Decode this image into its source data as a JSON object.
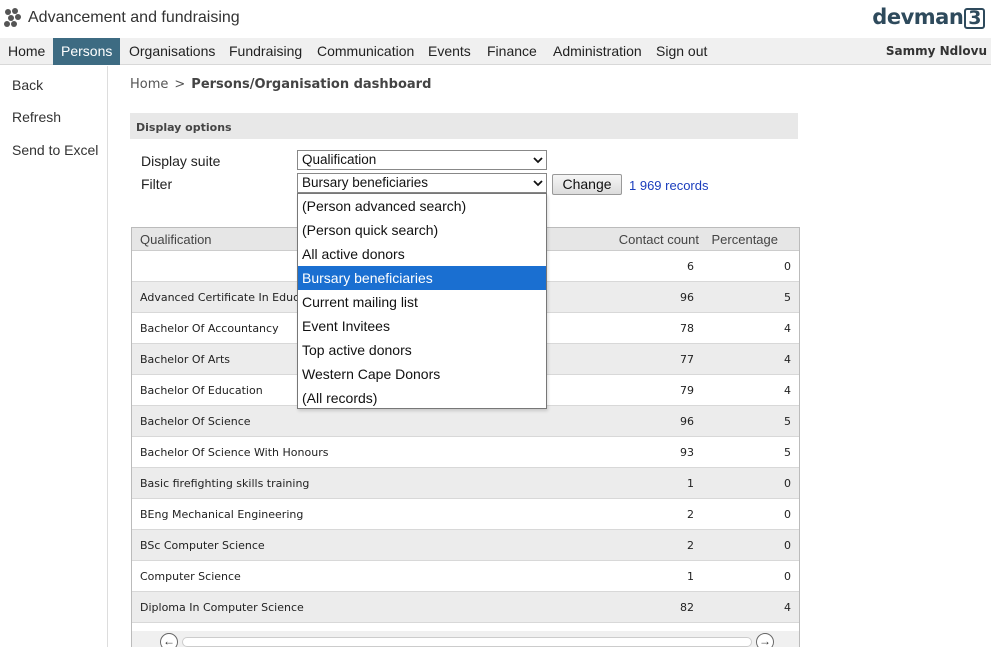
{
  "app": {
    "title": "Advancement and fundraising",
    "brand_text": "devman",
    "brand_num": "3",
    "user": "Sammy Ndlovu"
  },
  "nav": [
    "Home",
    "Persons",
    "Organisations",
    "Fundraising",
    "Communication",
    "Events",
    "Finance",
    "Administration",
    "Sign out"
  ],
  "nav_active": "Persons",
  "sidebar": [
    "Back",
    "Refresh",
    "Send to Excel"
  ],
  "breadcrumb": {
    "home": "Home",
    "sep": ">",
    "current": "Persons/Organisation dashboard"
  },
  "display_options": {
    "header": "Display options",
    "suite_label": "Display suite",
    "suite_value": "Qualification",
    "filter_label": "Filter",
    "filter_value": "Bursary beneficiaries",
    "change_label": "Change",
    "records": "1 969 records"
  },
  "filter_options": [
    "(Person advanced search)",
    "(Person quick search)",
    "All active donors",
    "Bursary beneficiaries",
    "Current mailing list",
    "Event Invitees",
    "Top active donors",
    "Western Cape Donors",
    "(All records)"
  ],
  "filter_selected_index": 3,
  "table": {
    "headers": {
      "name": "Qualification",
      "count": "Contact count",
      "pct": "Percentage"
    },
    "rows": [
      {
        "name": "",
        "count": "6",
        "pct": "0"
      },
      {
        "name": "Advanced Certificate In Education",
        "count": "96",
        "pct": "5"
      },
      {
        "name": "Bachelor Of Accountancy",
        "count": "78",
        "pct": "4"
      },
      {
        "name": "Bachelor Of Arts",
        "count": "77",
        "pct": "4"
      },
      {
        "name": "Bachelor Of Education",
        "count": "79",
        "pct": "4"
      },
      {
        "name": "Bachelor Of Science",
        "count": "96",
        "pct": "5"
      },
      {
        "name": "Bachelor Of Science With Honours",
        "count": "93",
        "pct": "5"
      },
      {
        "name": "Basic firefighting skills training",
        "count": "1",
        "pct": "0"
      },
      {
        "name": "BEng Mechanical Engineering",
        "count": "2",
        "pct": "0"
      },
      {
        "name": "BSc Computer Science",
        "count": "2",
        "pct": "0"
      },
      {
        "name": "Computer Science",
        "count": "1",
        "pct": "0"
      },
      {
        "name": "Diploma In Computer Science",
        "count": "82",
        "pct": "4"
      }
    ]
  },
  "colors": {
    "nav_active_bg": "#3d6b82",
    "selected_bg": "#1a6fd1",
    "link": "#1a3dbd"
  },
  "icons": [
    "logo-icon",
    "chevron-down-icon",
    "scroll-left-icon",
    "scroll-right-icon"
  ]
}
